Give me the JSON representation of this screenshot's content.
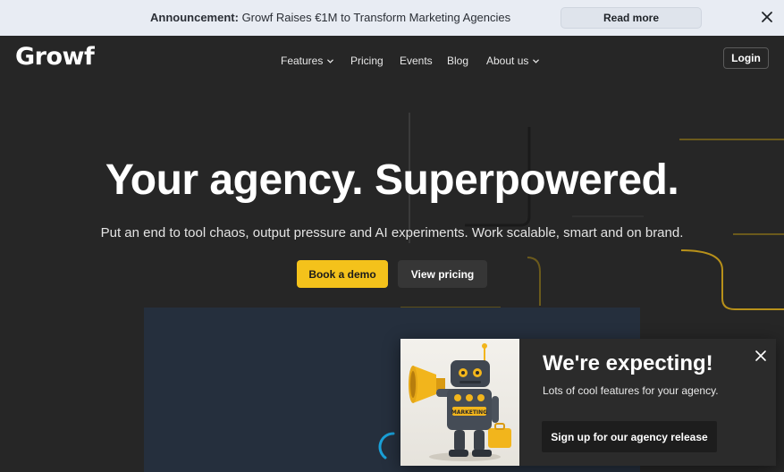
{
  "announcement": {
    "label": "Announcement:",
    "text": " Growf Raises €1M to Transform Marketing Agencies",
    "read_more": "Read more",
    "close_icon": "close-icon"
  },
  "nav": {
    "logo": "Growf",
    "links": [
      {
        "label": "Features",
        "has_dropdown": true
      },
      {
        "label": "Pricing",
        "has_dropdown": false
      },
      {
        "label": "Events",
        "has_dropdown": false
      },
      {
        "label": "Blog",
        "has_dropdown": false
      },
      {
        "label": "About us",
        "has_dropdown": true
      }
    ],
    "login": "Login"
  },
  "hero": {
    "title": "Your agency. Superpowered.",
    "subtitle": "Put an end to tool chaos, output pressure and AI experiments. Work scalable, smart and on brand.",
    "cta_primary": "Book a demo",
    "cta_secondary": "View pricing"
  },
  "popup": {
    "title": "We're expecting!",
    "subtitle": "Lots of cool features for your agency.",
    "button": "Sign up for our agency release",
    "image_label": "MARKETING"
  },
  "colors": {
    "accent": "#f4c21b",
    "background": "#262626",
    "announcement_bg": "#e8ecf3",
    "video_bg": "#252f3d"
  }
}
